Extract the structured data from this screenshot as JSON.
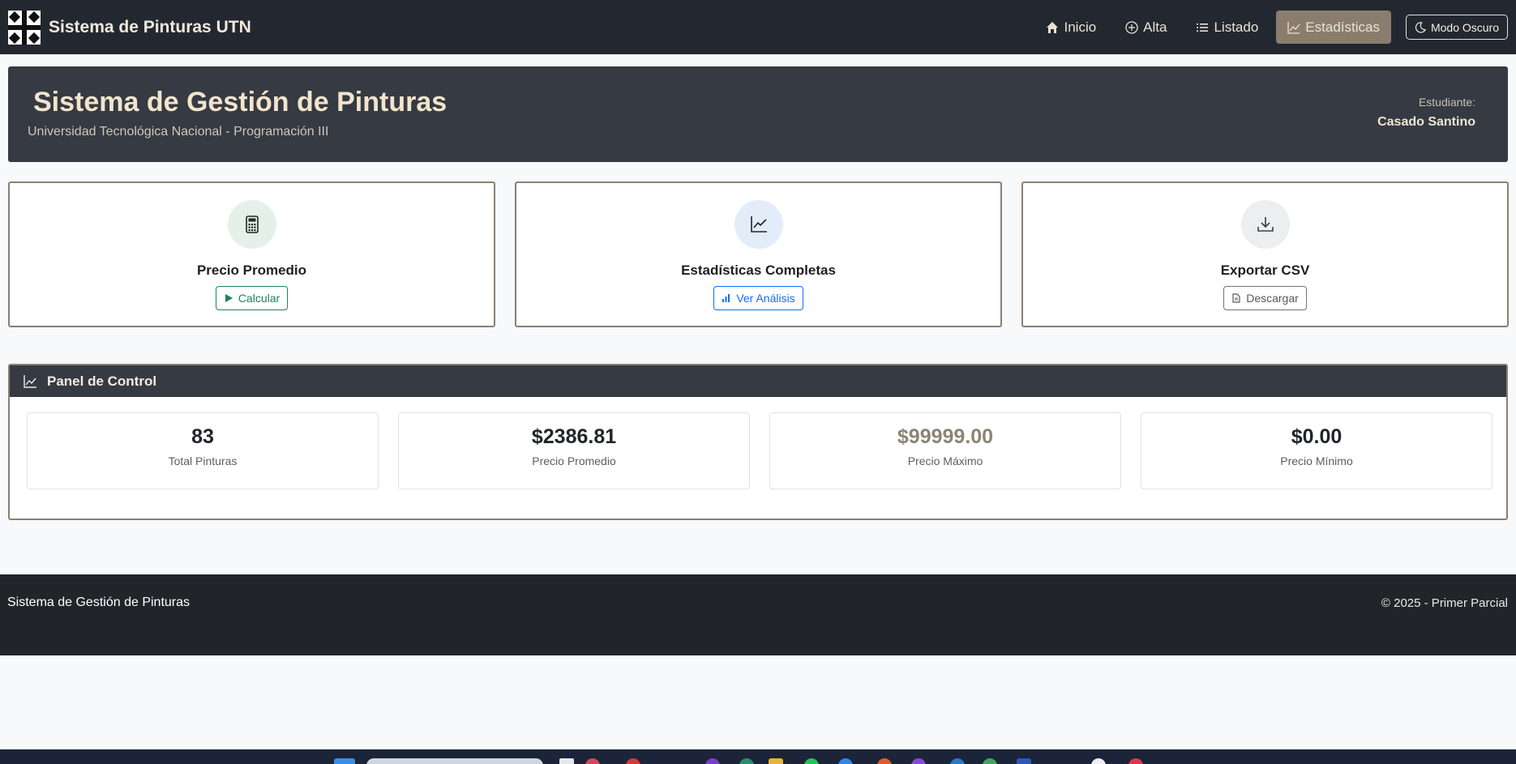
{
  "navbar": {
    "brand_title": "Sistema de Pinturas UTN",
    "links": [
      {
        "label": "Inicio",
        "icon": "home-icon"
      },
      {
        "label": "Alta",
        "icon": "plus-circle-icon"
      },
      {
        "label": "Listado",
        "icon": "list-icon"
      },
      {
        "label": "Estadísticas",
        "icon": "chart-line-icon",
        "active": true
      }
    ],
    "dark_mode_label": "Modo Oscuro"
  },
  "banner": {
    "title": "Sistema de Gestión de Pinturas",
    "subtitle": "Universidad Tecnológica Nacional - Programación III",
    "student_label": "Estudiante:",
    "student_name": "Casado Santino"
  },
  "cards": [
    {
      "title": "Precio Promedio",
      "button": "Calcular",
      "icon": "calculator-icon",
      "button_icon": "play-icon",
      "accent": "#198754"
    },
    {
      "title": "Estadísticas Completas",
      "button": "Ver Análisis",
      "icon": "chart-line-icon",
      "button_icon": "bar-chart-icon",
      "accent": "#0d6efd"
    },
    {
      "title": "Exportar CSV",
      "button": "Descargar",
      "icon": "download-icon",
      "button_icon": "file-icon",
      "accent": "#6c757d"
    }
  ],
  "panel": {
    "title": "Panel de Control",
    "stats": [
      {
        "value": "83",
        "label": "Total Pinturas"
      },
      {
        "value": "$2386.81",
        "label": "Precio Promedio"
      },
      {
        "value": "$99999.00",
        "label": "Precio Máximo",
        "color": "#8d8474"
      },
      {
        "value": "$0.00",
        "label": "Precio Mínimo"
      }
    ]
  },
  "footer": {
    "left": "Sistema de Gestión de Pinturas",
    "right": "© 2025 - Primer Parcial"
  }
}
